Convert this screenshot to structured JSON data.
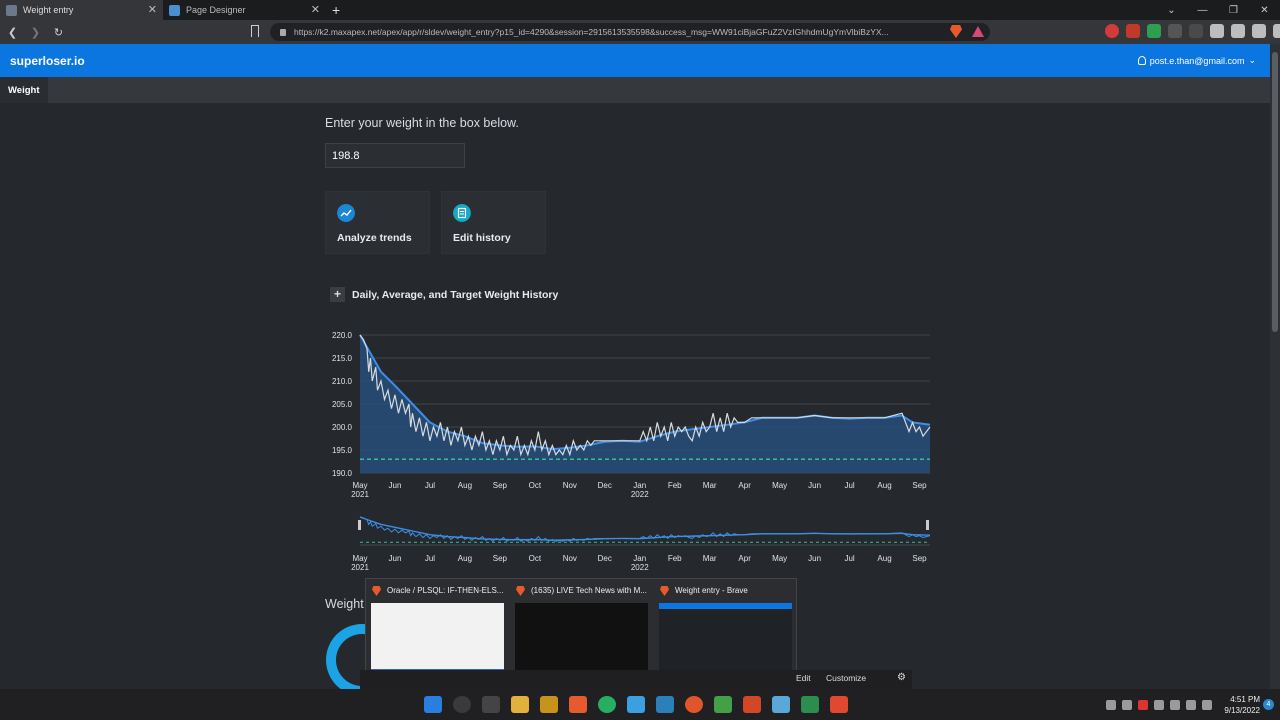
{
  "browser": {
    "tabs": [
      {
        "title": "Weight entry",
        "active": true
      },
      {
        "title": "Page Designer",
        "active": false
      }
    ],
    "url": "https://k2.maxapex.net/apex/app/r/sldev/weight_entry?p15_id=4290&session=2915613535598&success_msg=WW91ciBjaGFuZ2VzIGhhdmUgYmVlbiBzYX..."
  },
  "app": {
    "brand": "superloser.io",
    "user": "post.e.than@gmail.com",
    "nav_tab": "Weight"
  },
  "form": {
    "prompt": "Enter your weight in the box below.",
    "weight_value": "198.8"
  },
  "cards": [
    {
      "label": "Analyze trends",
      "icon": "chart-trend-icon",
      "color": "#1b88d6"
    },
    {
      "label": "Edit history",
      "icon": "document-icon",
      "color": "#16a8c4"
    }
  ],
  "chart_region": {
    "title": "Daily, Average, and Target Weight History"
  },
  "chart_data": {
    "type": "line",
    "title": "",
    "ylim": [
      190,
      220
    ],
    "y_ticks": [
      "220.0",
      "215.0",
      "210.0",
      "205.0",
      "200.0",
      "195.0",
      "190.0"
    ],
    "x_ticks": [
      {
        "label": "May",
        "sub": "2021"
      },
      {
        "label": "Jun",
        "sub": ""
      },
      {
        "label": "Jul",
        "sub": ""
      },
      {
        "label": "Aug",
        "sub": ""
      },
      {
        "label": "Sep",
        "sub": ""
      },
      {
        "label": "Oct",
        "sub": ""
      },
      {
        "label": "Nov",
        "sub": ""
      },
      {
        "label": "Dec",
        "sub": ""
      },
      {
        "label": "Jan",
        "sub": "2022"
      },
      {
        "label": "Feb",
        "sub": ""
      },
      {
        "label": "Mar",
        "sub": ""
      },
      {
        "label": "Apr",
        "sub": ""
      },
      {
        "label": "May",
        "sub": ""
      },
      {
        "label": "Jun",
        "sub": ""
      },
      {
        "label": "Jul",
        "sub": ""
      },
      {
        "label": "Aug",
        "sub": ""
      },
      {
        "label": "Sep",
        "sub": ""
      }
    ],
    "x_range_months": [
      0,
      16.3
    ],
    "target": 193,
    "series": [
      {
        "kind": "average",
        "color": "#3b8fe8",
        "points": [
          [
            0,
            220
          ],
          [
            0.3,
            216
          ],
          [
            0.6,
            212
          ],
          [
            1,
            209
          ],
          [
            1.5,
            205
          ],
          [
            2,
            201
          ],
          [
            2.5,
            199
          ],
          [
            3,
            198
          ],
          [
            3.5,
            196.5
          ],
          [
            4,
            196
          ],
          [
            4.5,
            195.7
          ],
          [
            5,
            195.8
          ],
          [
            5.5,
            195.2
          ],
          [
            6,
            195.5
          ],
          [
            6.5,
            196
          ],
          [
            7,
            196.8
          ],
          [
            7.5,
            197
          ],
          [
            8,
            196.8
          ],
          [
            8.5,
            198
          ],
          [
            9,
            199
          ],
          [
            9.5,
            199.5
          ],
          [
            10,
            200
          ],
          [
            10.5,
            200.5
          ],
          [
            11,
            201
          ],
          [
            11.5,
            202
          ],
          [
            12,
            202
          ],
          [
            12.5,
            202
          ],
          [
            13,
            202.5
          ],
          [
            13.5,
            202
          ],
          [
            14,
            201.8
          ],
          [
            14.5,
            202
          ],
          [
            15,
            202
          ],
          [
            15.5,
            202.5
          ],
          [
            15.8,
            201
          ],
          [
            16.3,
            200.5
          ]
        ]
      },
      {
        "kind": "daily",
        "color": "#d6dbe0",
        "points": [
          [
            0,
            220
          ],
          [
            0.1,
            219
          ],
          [
            0.2,
            217
          ],
          [
            0.25,
            212
          ],
          [
            0.3,
            215
          ],
          [
            0.35,
            210
          ],
          [
            0.45,
            213
          ],
          [
            0.5,
            208
          ],
          [
            0.6,
            210
          ],
          [
            0.7,
            206
          ],
          [
            0.8,
            208
          ],
          [
            0.9,
            204
          ],
          [
            1,
            207
          ],
          [
            1.1,
            203
          ],
          [
            1.2,
            206
          ],
          [
            1.3,
            203
          ],
          [
            1.4,
            205
          ],
          [
            1.45,
            200
          ],
          [
            1.5,
            203
          ],
          [
            1.6,
            199
          ],
          [
            1.7,
            202
          ],
          [
            1.8,
            198
          ],
          [
            1.9,
            201
          ],
          [
            2,
            197
          ],
          [
            2.1,
            200
          ],
          [
            2.2,
            198
          ],
          [
            2.3,
            201
          ],
          [
            2.4,
            197
          ],
          [
            2.5,
            200
          ],
          [
            2.6,
            196
          ],
          [
            2.7,
            199
          ],
          [
            2.8,
            197
          ],
          [
            2.9,
            200
          ],
          [
            3,
            196
          ],
          [
            3.1,
            198
          ],
          [
            3.2,
            195
          ],
          [
            3.3,
            198
          ],
          [
            3.4,
            196
          ],
          [
            3.5,
            199
          ],
          [
            3.6,
            195
          ],
          [
            3.7,
            197
          ],
          [
            3.8,
            194
          ],
          [
            3.9,
            197
          ],
          [
            4,
            195
          ],
          [
            4.1,
            198
          ],
          [
            4.2,
            194
          ],
          [
            4.3,
            196
          ],
          [
            4.4,
            195
          ],
          [
            4.5,
            198
          ],
          [
            4.6,
            194
          ],
          [
            4.7,
            196
          ],
          [
            4.8,
            194
          ],
          [
            4.9,
            197
          ],
          [
            5,
            195
          ],
          [
            5.1,
            199
          ],
          [
            5.2,
            195
          ],
          [
            5.3,
            197
          ],
          [
            5.4,
            194
          ],
          [
            5.5,
            196
          ],
          [
            5.6,
            194
          ],
          [
            5.7,
            195
          ],
          [
            5.8,
            194
          ],
          [
            5.9,
            196
          ],
          [
            6,
            194
          ],
          [
            6.1,
            197
          ],
          [
            6.2,
            195
          ],
          [
            6.3,
            196
          ],
          [
            6.4,
            195
          ],
          [
            6.5,
            197
          ],
          [
            6.6,
            196
          ],
          [
            6.7,
            197
          ],
          [
            7,
            197
          ],
          [
            7.3,
            197
          ],
          [
            7.5,
            197
          ],
          [
            7.8,
            197
          ],
          [
            8,
            197
          ],
          [
            8.1,
            199
          ],
          [
            8.2,
            197
          ],
          [
            8.3,
            200
          ],
          [
            8.4,
            197
          ],
          [
            8.5,
            201
          ],
          [
            8.6,
            198
          ],
          [
            8.7,
            200
          ],
          [
            8.8,
            197
          ],
          [
            8.9,
            201
          ],
          [
            9,
            198
          ],
          [
            9.1,
            200
          ],
          [
            9.2,
            199
          ],
          [
            9.3,
            200
          ],
          [
            9.4,
            198
          ],
          [
            9.5,
            197
          ],
          [
            9.6,
            200
          ],
          [
            9.7,
            198
          ],
          [
            9.8,
            201
          ],
          [
            9.9,
            199
          ],
          [
            10,
            200
          ],
          [
            10.1,
            203
          ],
          [
            10.2,
            199
          ],
          [
            10.3,
            202
          ],
          [
            10.4,
            199
          ],
          [
            10.5,
            203
          ],
          [
            10.6,
            200
          ],
          [
            10.7,
            202
          ],
          [
            10.8,
            201
          ],
          [
            11,
            201
          ],
          [
            11.2,
            202
          ],
          [
            11.5,
            202
          ],
          [
            12,
            202
          ],
          [
            12.5,
            202
          ],
          [
            13,
            202.5
          ],
          [
            13.5,
            202
          ],
          [
            14,
            202
          ],
          [
            14.5,
            202
          ],
          [
            15,
            202
          ],
          [
            15.5,
            203
          ],
          [
            15.6,
            201
          ],
          [
            15.7,
            199
          ],
          [
            15.8,
            201
          ],
          [
            15.9,
            199
          ],
          [
            16,
            200
          ],
          [
            16.1,
            198
          ],
          [
            16.3,
            200
          ]
        ]
      }
    ]
  },
  "section2": {
    "title": "Weight"
  },
  "thumbnails": [
    {
      "title": "Oracle / PLSQL: IF-THEN-ELS..."
    },
    {
      "title": "(1635) LIVE Tech News with M..."
    },
    {
      "title": "Weight entry - Brave"
    }
  ],
  "devbar": {
    "edit": "Edit",
    "customize": "Customize"
  },
  "clock": {
    "time": "4:51 PM",
    "date": "9/13/2022",
    "notifications": "4"
  }
}
